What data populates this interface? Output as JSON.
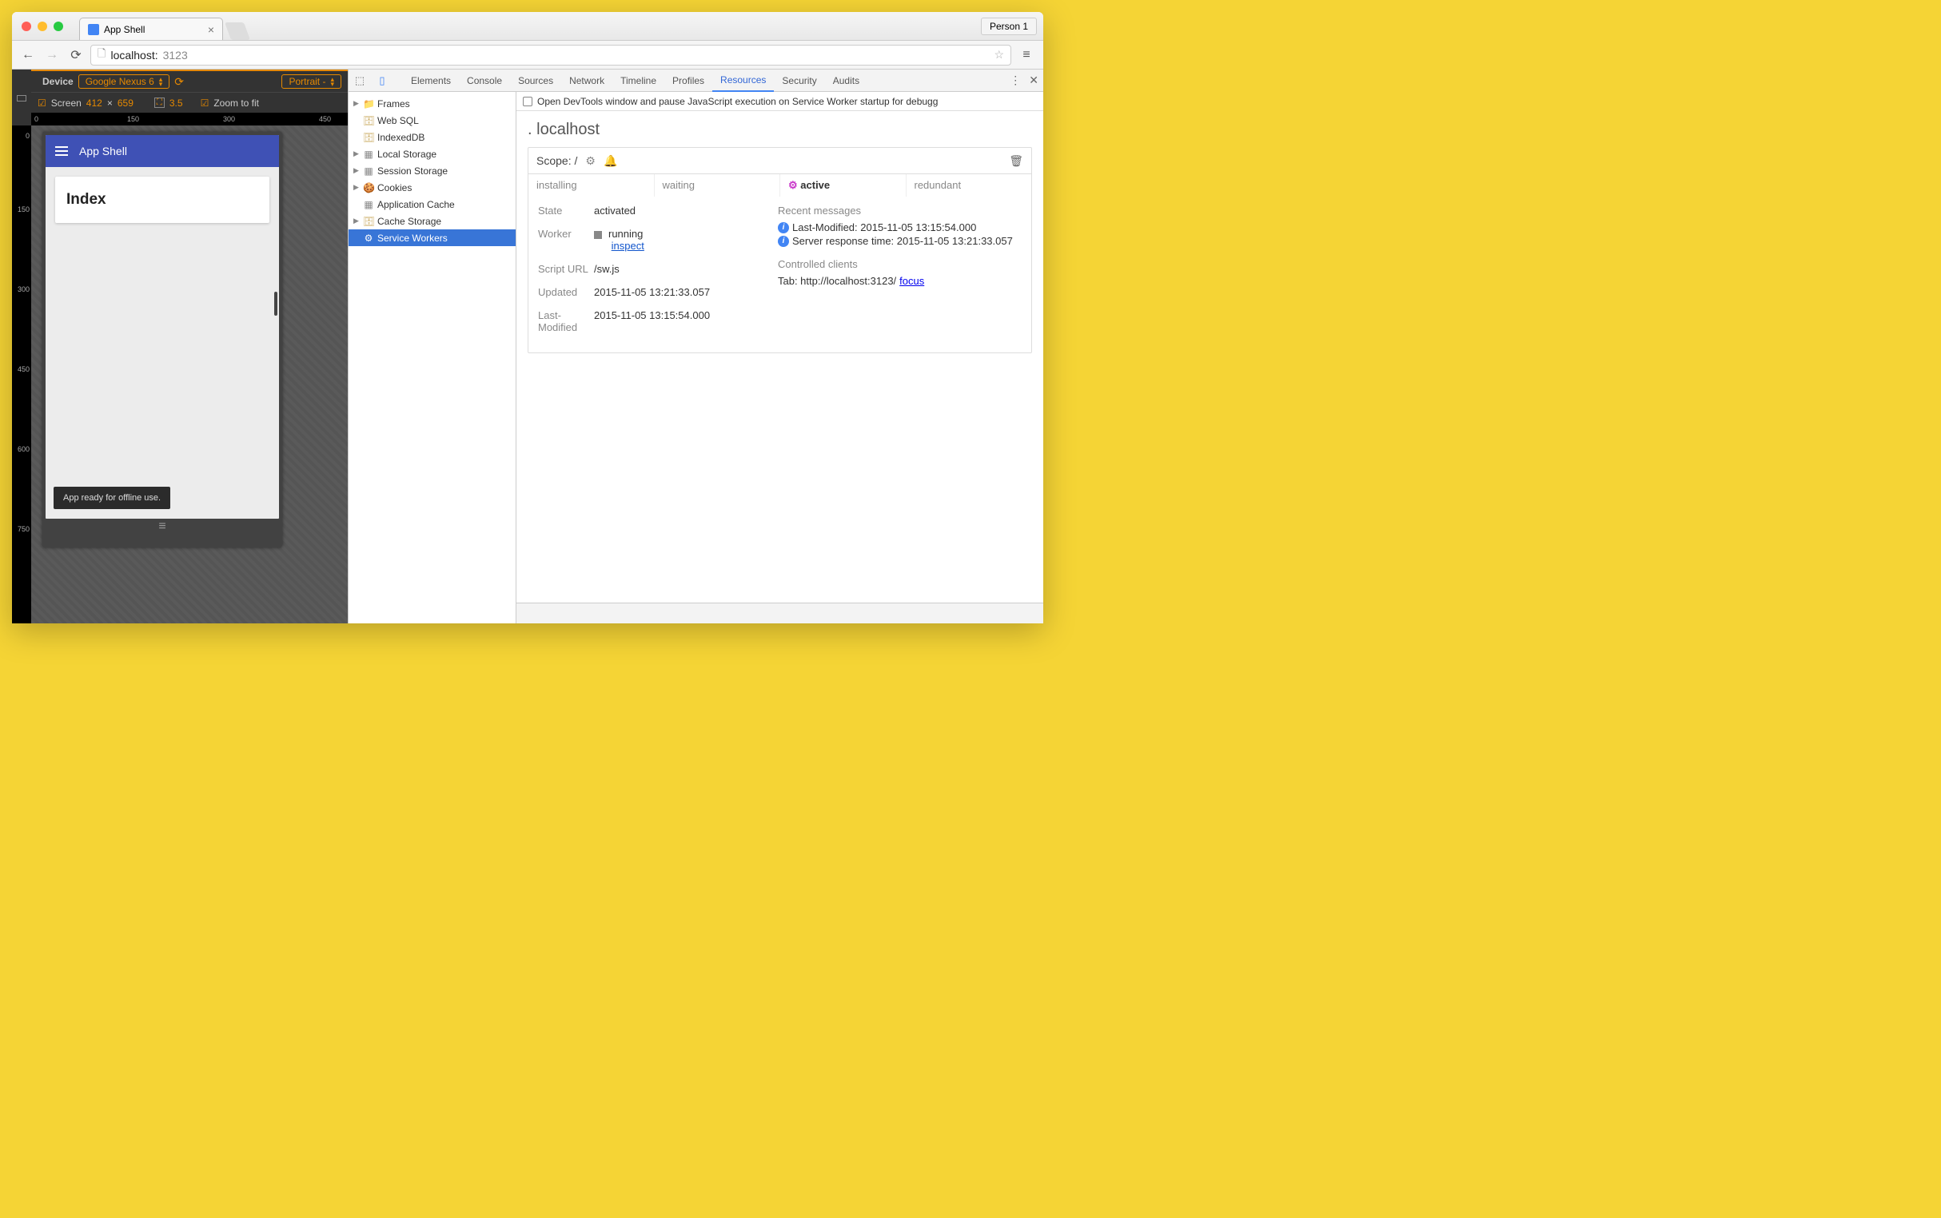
{
  "browser": {
    "tab_title": "App Shell",
    "person_label": "Person 1",
    "address": {
      "host": "localhost:",
      "port": "3123"
    }
  },
  "device_toolbar": {
    "device_label": "Device",
    "device_value": "Google Nexus 6",
    "orientation_value": "Portrait -",
    "screen_label": "Screen",
    "width": "412",
    "mult": "×",
    "height": "659",
    "dpr": "3.5",
    "zoom_label": "Zoom to fit",
    "ruler_h": [
      "0",
      "150",
      "300",
      "450"
    ],
    "ruler_v": [
      "0",
      "150",
      "300",
      "450",
      "600",
      "750"
    ]
  },
  "app_preview": {
    "header_title": "App Shell",
    "card_title": "Index",
    "toast_text": "App ready for offline use."
  },
  "devtools": {
    "tabs": [
      "Elements",
      "Console",
      "Sources",
      "Network",
      "Timeline",
      "Profiles",
      "Resources",
      "Security",
      "Audits"
    ],
    "active_tab": "Resources",
    "resources_tree": [
      {
        "icon": "folder",
        "label": "Frames",
        "expand": true
      },
      {
        "icon": "db",
        "label": "Web SQL"
      },
      {
        "icon": "db",
        "label": "IndexedDB"
      },
      {
        "icon": "table",
        "label": "Local Storage",
        "expand": true
      },
      {
        "icon": "table",
        "label": "Session Storage",
        "expand": true
      },
      {
        "icon": "cookie",
        "label": "Cookies",
        "expand": true
      },
      {
        "icon": "table",
        "label": "Application Cache"
      },
      {
        "icon": "db",
        "label": "Cache Storage",
        "expand": true
      },
      {
        "icon": "gear",
        "label": "Service Workers",
        "selected": true
      }
    ],
    "sw": {
      "startup_checkbox_label": "Open DevTools window and pause JavaScript execution on Service Worker startup for debugg",
      "host": "localhost",
      "scope_label": "Scope: /",
      "status_tabs": [
        "installing",
        "waiting",
        "active",
        "redundant"
      ],
      "active_status_tab": "active",
      "state_label": "State",
      "state_value": "activated",
      "worker_label": "Worker",
      "worker_status": "running",
      "worker_inspect": "inspect",
      "script_label": "Script URL",
      "script_value": "/sw.js",
      "updated_label": "Updated",
      "updated_value": "2015-11-05 13:21:33.057",
      "lastmod_label": "Last-Modified",
      "lastmod_value": "2015-11-05 13:15:54.000",
      "recent_label": "Recent messages",
      "msg1": "Last-Modified: 2015-11-05 13:15:54.000",
      "msg2": "Server response time: 2015-11-05 13:21:33.057",
      "clients_label": "Controlled clients",
      "client_text": "Tab: http://localhost:3123/ ",
      "client_focus": "focus"
    }
  }
}
